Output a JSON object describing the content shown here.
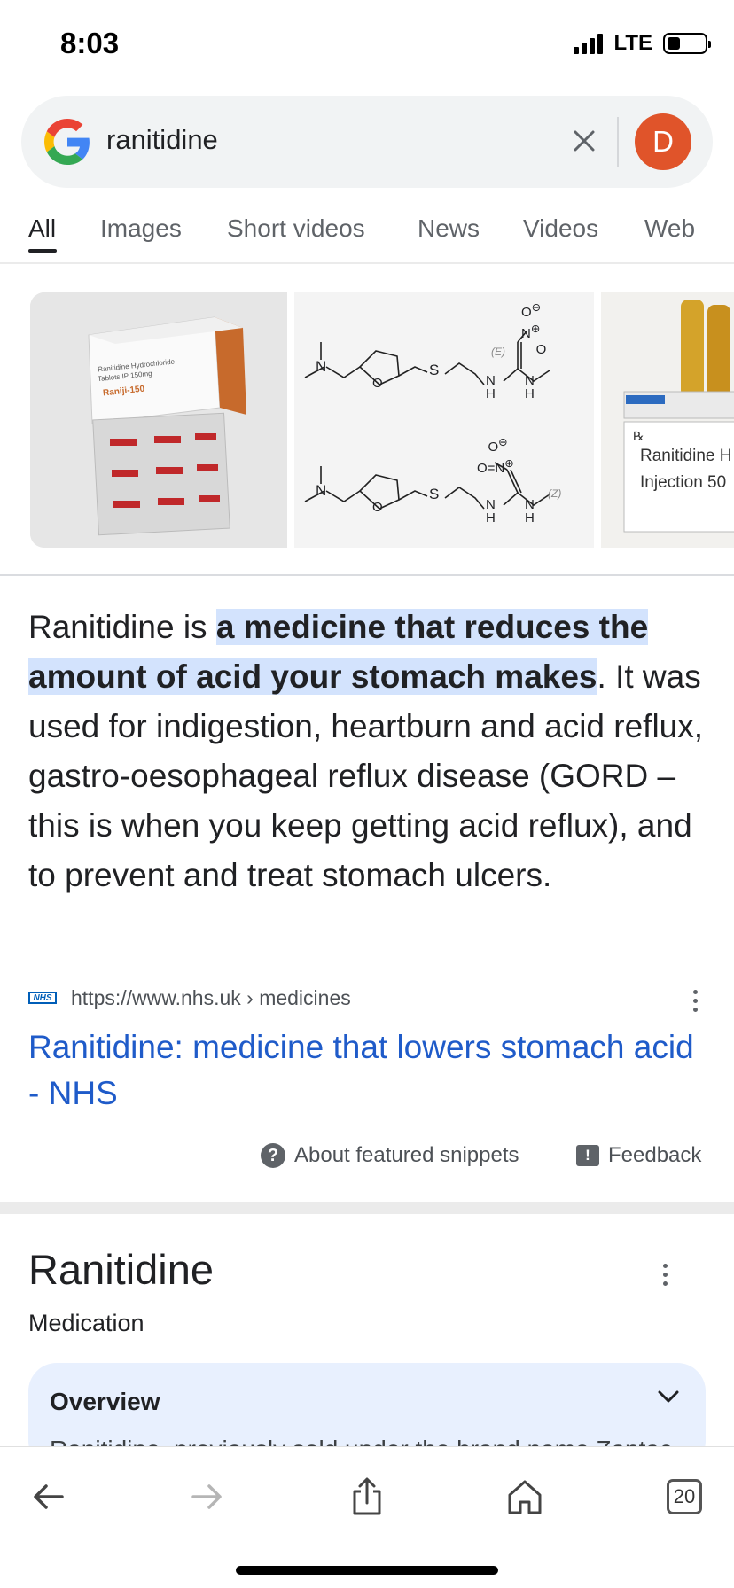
{
  "status_bar": {
    "time": "8:03",
    "network": "LTE",
    "battery_level": 0.35
  },
  "search": {
    "query": "ranitidine",
    "avatar_letter": "D"
  },
  "tabs": [
    {
      "label": "All",
      "active": true
    },
    {
      "label": "Images"
    },
    {
      "label": "Short videos"
    },
    {
      "label": "News"
    },
    {
      "label": "Videos"
    },
    {
      "label": "Web"
    }
  ],
  "images": {
    "box_brand": "Raniji-150",
    "box_caption_1": "Ranitidine Hydrochloride",
    "box_caption_2": "Tablets IP 150mg",
    "molecule_label_e": "(E)",
    "molecule_label_z": "(Z)",
    "ampoule_rx": "℞",
    "ampoule_text_1": "Ranitidine H",
    "ampoule_text_2": "Injection 50"
  },
  "snippet": {
    "prefix": "Ranitidine is ",
    "highlight": "a medicine that reduces the amount of acid your stomach makes",
    "rest": ". It was used for indigestion, heartburn and acid reflux, gastro-oesophageal reflux disease (GORD – this is when you keep getting acid reflux), and to prevent and treat stomach ulcers.",
    "source_logo": "NHS",
    "source_url": "https://www.nhs.uk › medicines",
    "link_title": "Ranitidine: medicine that lowers stomach acid - NHS",
    "about_label": "About featured snippets",
    "feedback_label": "Feedback"
  },
  "knowledge_panel": {
    "title": "Ranitidine",
    "subtitle": "Medication",
    "overview_label": "Overview",
    "overview_peek": "Ranitidine, previously sold under the brand name Zantac"
  },
  "toolbar": {
    "tab_count": "20"
  },
  "colors": {
    "link": "#1f5bc9",
    "highlight": "#d3e3fd",
    "avatar": "#e0542a",
    "overview_bg": "#e8f0fe"
  }
}
